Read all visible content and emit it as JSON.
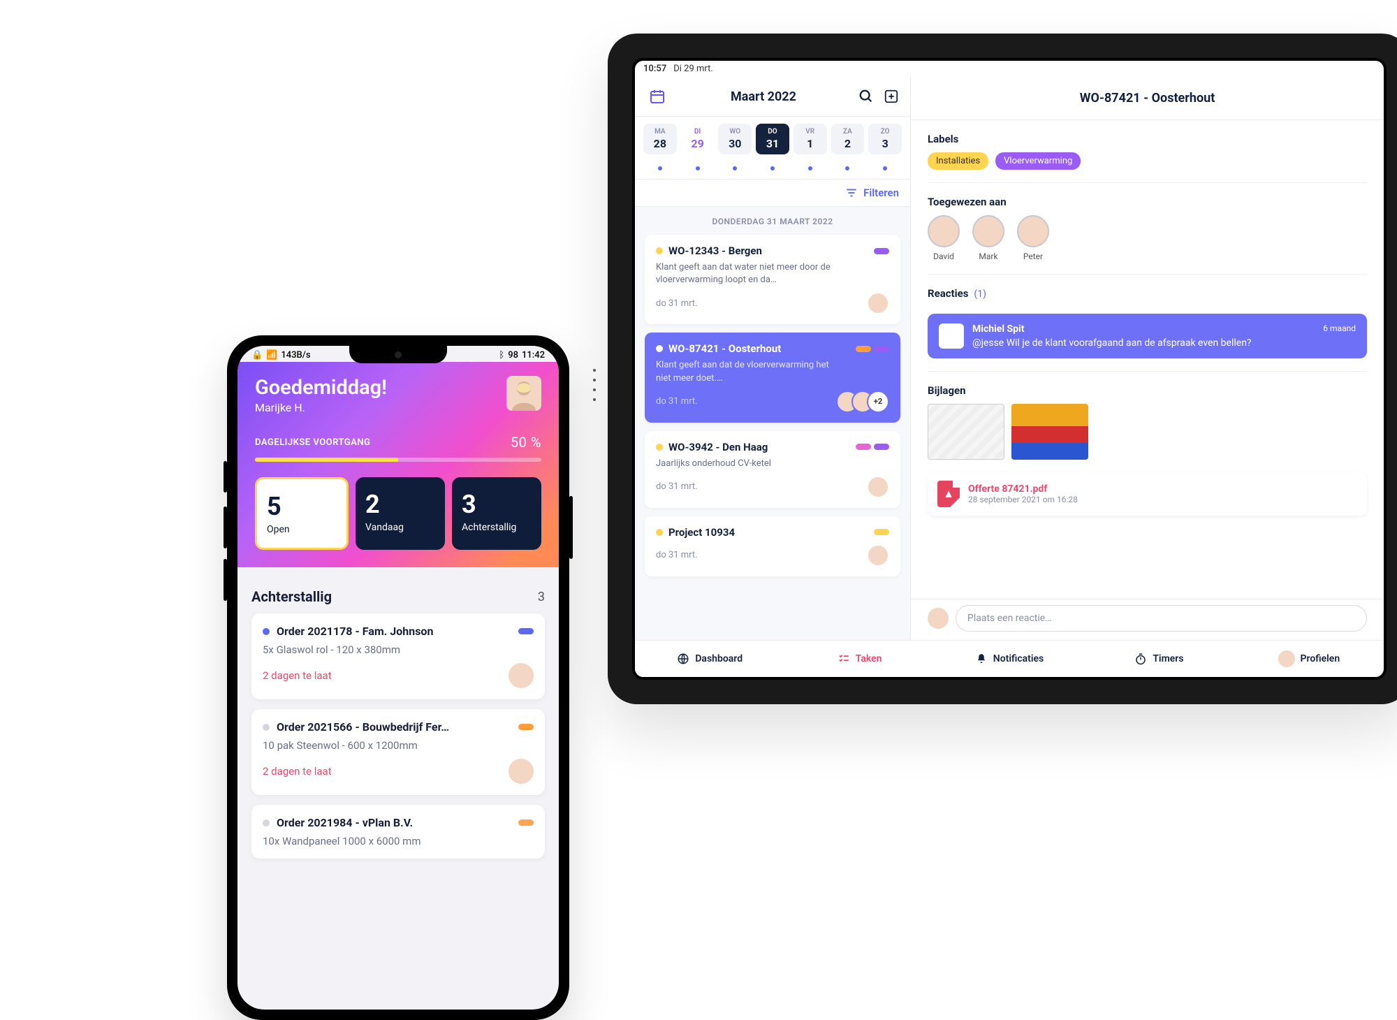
{
  "phone": {
    "status": {
      "left": "143B/s",
      "battery": "98",
      "time": "11:42"
    },
    "greeting": "Goedemiddag!",
    "userName": "Marijke H.",
    "progressLabel": "DAGELIJKSE VOORTGANG",
    "progressPct": "50 %",
    "stats": [
      {
        "num": "5",
        "label": "Open"
      },
      {
        "num": "2",
        "label": "Vandaag"
      },
      {
        "num": "3",
        "label": "Achterstallig"
      }
    ],
    "listTitle": "Achterstallig",
    "listCount": "3",
    "orders": [
      {
        "title": "Order 2021178 - Fam. Johnson",
        "desc": "5x Glaswol rol - 120 x 380mm",
        "late": "2 dagen te laat",
        "dot": "blue",
        "pill": "blue"
      },
      {
        "title": "Order 2021566 - Bouwbedrijf Fer…",
        "desc": "10 pak Steenwol - 600 x 1200mm",
        "late": "2 dagen te laat",
        "dot": "grey",
        "pill": "orange"
      },
      {
        "title": "Order 2021984 - vPlan B.V.",
        "desc": "10x Wandpaneel  1000 x 6000 mm",
        "late": "",
        "dot": "grey",
        "pill": "orange2"
      }
    ]
  },
  "tablet": {
    "status": {
      "time": "10:57",
      "date": "Di 29 mrt."
    },
    "monthTitle": "Maart 2022",
    "days": [
      {
        "dow": "MA",
        "num": "28"
      },
      {
        "dow": "DI",
        "num": "29",
        "today": true
      },
      {
        "dow": "WO",
        "num": "30"
      },
      {
        "dow": "DO",
        "num": "31",
        "selected": true
      },
      {
        "dow": "VR",
        "num": "1"
      },
      {
        "dow": "ZA",
        "num": "2"
      },
      {
        "dow": "ZO",
        "num": "3"
      }
    ],
    "filter": "Filteren",
    "taskDateHeader": "DONDERDAG 31 MAART 2022",
    "tasks": [
      {
        "dot": "yellow",
        "title": "WO-12343 - Bergen",
        "desc": "Klant geeft aan dat water niet meer door de vloerverwarming loopt en da…",
        "date": "do 31 mrt.",
        "pills": [
          "purple"
        ],
        "avatars": 1
      },
      {
        "dot": "",
        "title": "WO-87421 - Oosterhout",
        "desc": "Klant geeft aan dat de vloerverwarming het niet meer doet.…",
        "date": "do 31 mrt.",
        "pills": [
          "orange",
          "purple"
        ],
        "avatars": 2,
        "extra": "+2",
        "selected": true
      },
      {
        "dot": "yellow",
        "title": "WO-3942 - Den Haag",
        "desc": "Jaarlijks onderhoud CV-ketel",
        "date": "do 31 mrt.",
        "pills": [
          "pink",
          "purple"
        ],
        "avatars": 1
      },
      {
        "dot": "yellow",
        "title": "Project 10934",
        "desc": "",
        "date": "do 31 mrt.",
        "pills": [
          "yellow"
        ],
        "avatars": 1
      }
    ],
    "detail": {
      "title": "WO-87421 - Oosterhout",
      "labelsTitle": "Labels",
      "labels": [
        {
          "text": "Installaties",
          "cls": "yellow"
        },
        {
          "text": "Vloerverwarming",
          "cls": "purple"
        }
      ],
      "assignedTitle": "Toegewezen aan",
      "assignees": [
        "David",
        "Mark",
        "Peter"
      ],
      "reactionsTitle": "Reacties",
      "reactionsCount": "(1)",
      "reaction": {
        "name": "Michiel Spit",
        "text": "@jesse Wil je de klant voorafgaand aan de afspraak even bellen?",
        "time": "6 maand"
      },
      "attachmentsTitle": "Bijlagen",
      "pdf": {
        "title": "Offerte 87421.pdf",
        "date": "28 september 2021 om 16:28"
      },
      "replyPlaceholder": "Plaats een reactie…"
    },
    "tabs": {
      "dashboard": "Dashboard",
      "taken": "Taken",
      "notificaties": "Notificaties",
      "timers": "Timers",
      "profielen": "Profielen"
    }
  }
}
